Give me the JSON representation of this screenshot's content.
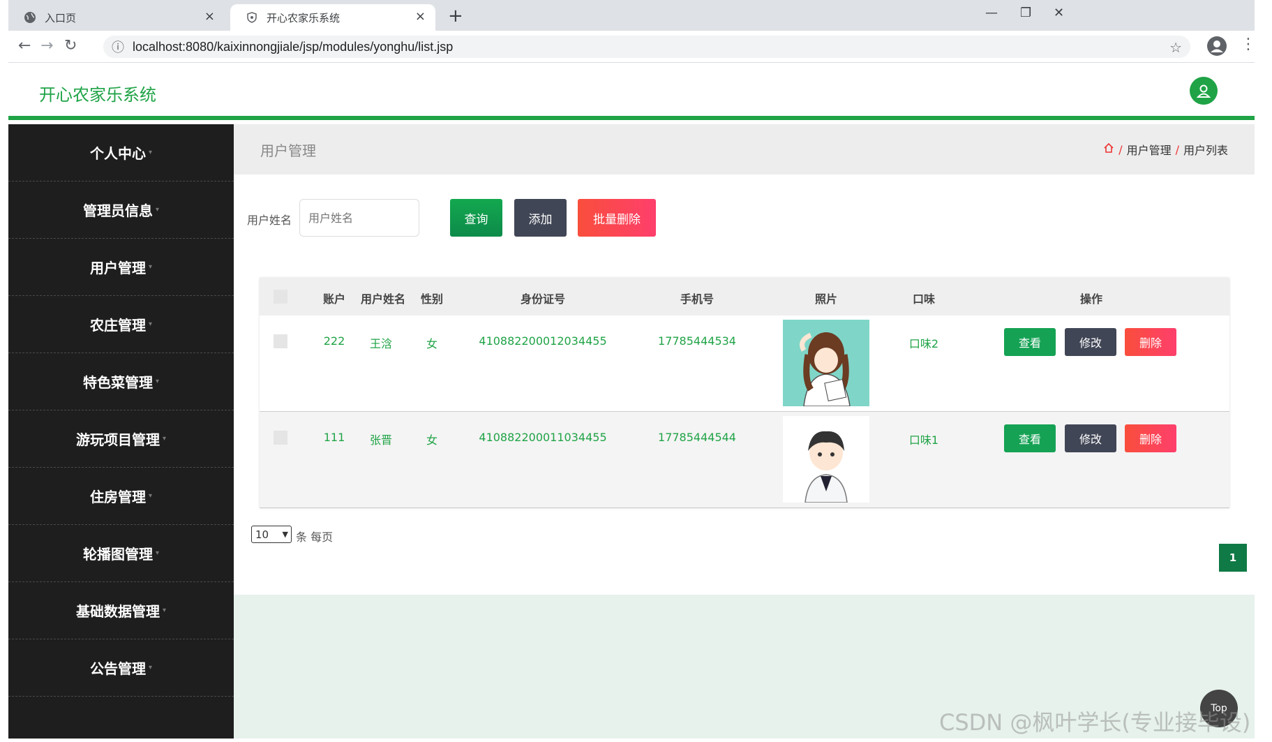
{
  "browser": {
    "tabs": [
      {
        "title": "入口页",
        "close": "×"
      },
      {
        "title": "开心农家乐系统",
        "close": "×"
      }
    ],
    "new_tab": "+",
    "window_controls": {
      "minimize": "—",
      "restore": "❐",
      "close": "✕"
    },
    "url": "localhost:8080/kaixinnongjiale/jsp/modules/yonghu/list.jsp",
    "nav": {
      "back": "←",
      "forward": "→",
      "reload": "↻",
      "info": "ⓘ",
      "star": "☆",
      "kebab": "⋮"
    }
  },
  "app": {
    "brand": "开心农家乐系统",
    "accent": "#1fa346"
  },
  "sidebar": {
    "items": [
      {
        "label": "个人中心"
      },
      {
        "label": "管理员信息"
      },
      {
        "label": "用户管理"
      },
      {
        "label": "农庄管理"
      },
      {
        "label": "特色菜管理"
      },
      {
        "label": "游玩项目管理"
      },
      {
        "label": "住房管理"
      },
      {
        "label": "轮播图管理"
      },
      {
        "label": "基础数据管理"
      },
      {
        "label": "公告管理"
      }
    ]
  },
  "breadcrumb": {
    "title": "用户管理",
    "items": [
      "用户管理",
      "用户列表"
    ],
    "separator": "/"
  },
  "search": {
    "label": "用户姓名",
    "placeholder": "用户姓名",
    "query_btn": "查询",
    "add_btn": "添加",
    "batch_delete_btn": "批量删除"
  },
  "table": {
    "headers": [
      "账户",
      "用户姓名",
      "性别",
      "身份证号",
      "手机号",
      "照片",
      "口味",
      "操作"
    ],
    "rows": [
      {
        "account": "222",
        "name": "王浛",
        "gender": "女",
        "id_no": "410882200012034455",
        "phone": "17785444534",
        "taste": "口味2"
      },
      {
        "account": "111",
        "name": "张晋",
        "gender": "女",
        "id_no": "410882200011034455",
        "phone": "17785444544",
        "taste": "口味1"
      }
    ],
    "actions": {
      "view": "查看",
      "edit": "修改",
      "delete": "删除"
    }
  },
  "pagination": {
    "page_size": "10",
    "page_size_suffix": "条 每页",
    "current_page": "1"
  },
  "top_button": "Top",
  "watermark": "CSDN @枫叶学长(专业接毕设)"
}
